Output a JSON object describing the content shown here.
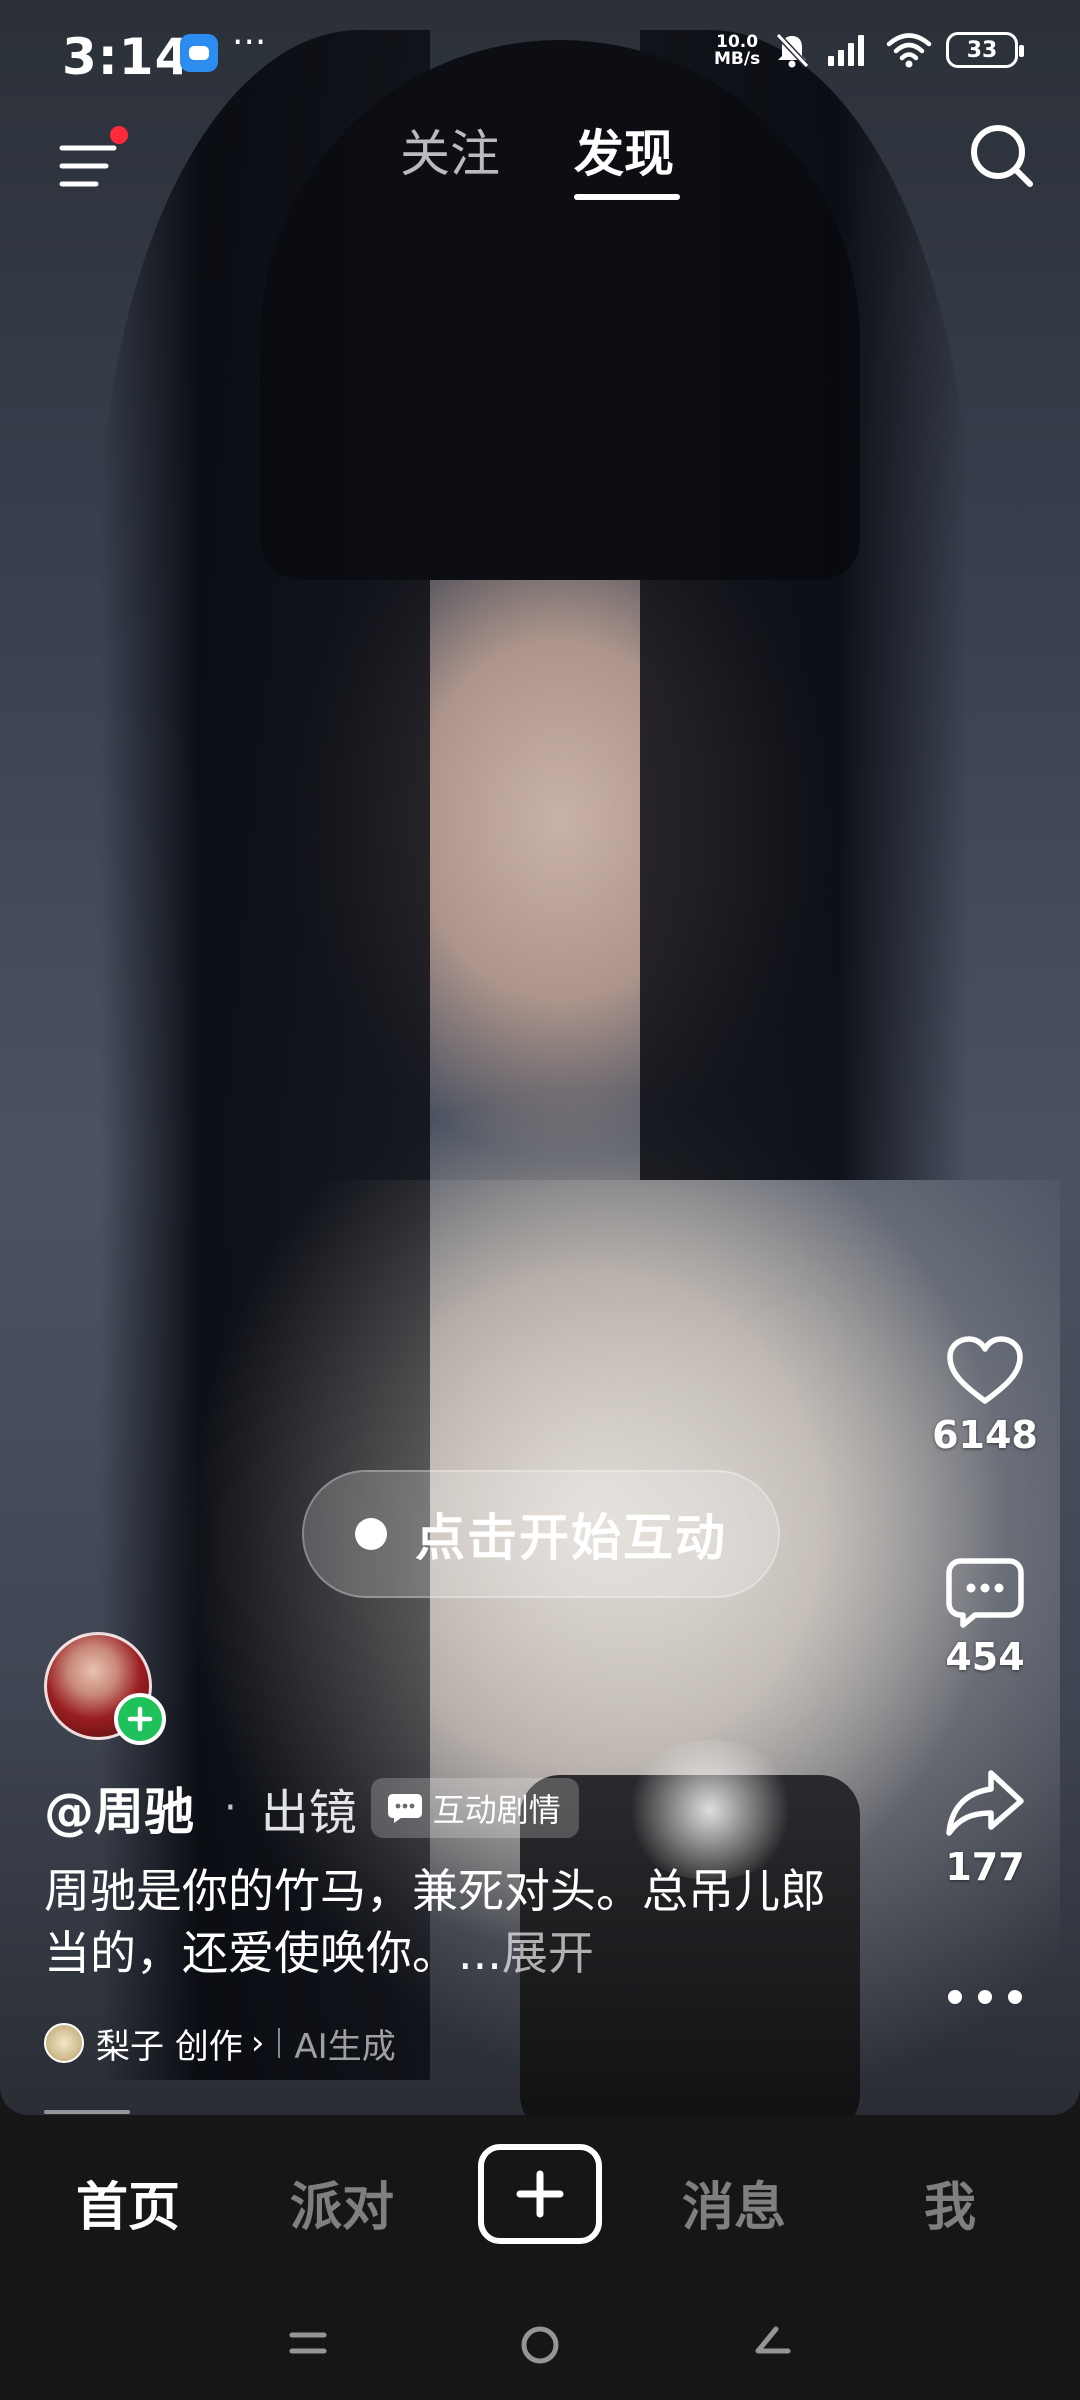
{
  "status_bar": {
    "time": "3:14",
    "more_dots": "···",
    "net_speed_value": "10.0",
    "net_speed_unit": "MB/s",
    "battery": "33",
    "icons": [
      "chat-app-icon",
      "bell-muted-icon",
      "signal-icon",
      "wifi-icon",
      "battery-icon"
    ]
  },
  "top_nav": {
    "tabs": [
      {
        "label": "关注",
        "active": false
      },
      {
        "label": "发现",
        "active": true
      }
    ],
    "notification_dot_color": "#ff2a3a"
  },
  "actions": {
    "like_count": "6148",
    "comment_count": "454",
    "share_count": "177"
  },
  "interact_button": {
    "label": "点击开始互动"
  },
  "post": {
    "author_name": "@周驰",
    "separator": "·",
    "author_role": "出镜",
    "tag_label": "互动剧情",
    "description": "周驰是你的竹马，兼死对头。总吊儿郎当的，还爱使唤你。...",
    "expand_label": "展开",
    "creator_name": "梨子 创作",
    "creator_chevron": "›",
    "ai_label": "AI生成",
    "follow_color": "#1fc15a"
  },
  "bottom_nav": {
    "items": [
      {
        "label": "首页",
        "active": true
      },
      {
        "label": "派对",
        "active": false
      },
      {
        "label": "消息",
        "active": false
      },
      {
        "label": "我",
        "active": false
      }
    ]
  }
}
